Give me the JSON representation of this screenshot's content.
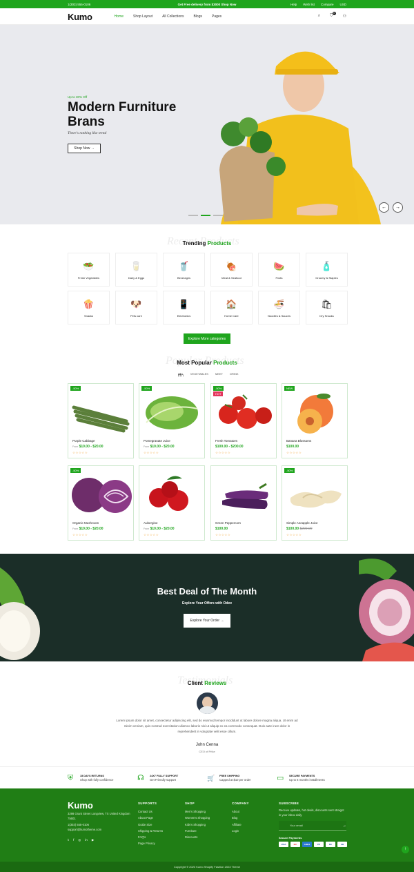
{
  "topbar": {
    "phone": "1(303) 555-0106",
    "promo": "Get Free delivery from $3000 Shop Now",
    "links": [
      "Help",
      "Wish list",
      "Compare",
      "USD"
    ]
  },
  "nav": {
    "logo": "Kumo",
    "links": [
      "Home",
      "Shop Layout",
      "All Collections",
      "Blogs",
      "Pages"
    ],
    "cart_count": "0"
  },
  "hero": {
    "discount": "Up to 30% Off",
    "title": "Modern Furniture Brans",
    "subtitle": "There's nothing like trend",
    "button": "Shop Now →",
    "prev": "←",
    "next": "→"
  },
  "trending": {
    "ghost": "Recent Products",
    "title_a": "Trending",
    "title_b": "Products",
    "categories": [
      {
        "label": "Fresh Vegetables",
        "icon": "vegetables-icon",
        "glyph": "🥗"
      },
      {
        "label": "Dairy & Eggs",
        "icon": "dairy-icon",
        "glyph": "🥛"
      },
      {
        "label": "Beverages",
        "icon": "beverages-icon",
        "glyph": "🥤"
      },
      {
        "label": "Meat & Seafood",
        "icon": "meat-icon",
        "glyph": "🍖"
      },
      {
        "label": "Fruits",
        "icon": "fruits-icon",
        "glyph": "🍉"
      },
      {
        "label": "Grocery & Staples",
        "icon": "grocery-icon",
        "glyph": "🧴"
      },
      {
        "label": "Snacks",
        "icon": "snacks-icon",
        "glyph": "🍿"
      },
      {
        "label": "Pets care",
        "icon": "pets-icon",
        "glyph": "🐶"
      },
      {
        "label": "Electronics",
        "icon": "electronics-icon",
        "glyph": "📱"
      },
      {
        "label": "Home Care",
        "icon": "home-care-icon",
        "glyph": "🏠"
      },
      {
        "label": "Noodles & Sauces",
        "icon": "noodles-icon",
        "glyph": "🍜"
      },
      {
        "label": "Dry Snacks",
        "icon": "dry-snacks-icon",
        "glyph": "🛍"
      }
    ],
    "button": "Explore More categories"
  },
  "popular": {
    "ghost": "Popular Products",
    "title_a": "Most Popular",
    "title_b": "Products",
    "tabs": [
      "ALL",
      "VEGETABLES",
      "MEET",
      "DRINK"
    ],
    "products": [
      {
        "name": "Purple Cabbage",
        "from": "From",
        "price": "$10.00 - $20.00",
        "old": "",
        "badge": "-50%",
        "badge2": "",
        "art": "asparagus"
      },
      {
        "name": "Pomegranate Juice",
        "from": "From",
        "price": "$10.00 - $20.00",
        "old": "",
        "badge": "-50%",
        "badge2": "",
        "art": "lettuce"
      },
      {
        "name": "Fresh Tomatoes",
        "from": "",
        "price": "$100.00 - $200.00",
        "old": "",
        "badge": "-50%",
        "badge2": "HOT",
        "art": "tomatoes"
      },
      {
        "name": "Banana Blossoms",
        "from": "",
        "price": "$100.00",
        "old": "",
        "badge": "NEW",
        "badge2": "",
        "art": "peach"
      },
      {
        "name": "Organic Mushroom",
        "from": "From",
        "price": "$10.00 - $20.00",
        "old": "",
        "badge": "-50%",
        "badge2": "",
        "art": "cabbage"
      },
      {
        "name": "Aubergine",
        "from": "From",
        "price": "$10.00 - $20.00",
        "old": "",
        "badge": "",
        "badge2": "",
        "art": "cherries"
      },
      {
        "name": "Green Peppercorn",
        "from": "",
        "price": "$100.00",
        "old": "",
        "badge": "",
        "badge2": "",
        "art": "eggplant"
      },
      {
        "name": "Simple Aneapple Juice",
        "from": "",
        "price": "$100.00",
        "old": "$200.00",
        "badge": "-50%",
        "badge2": "",
        "art": "ginger"
      }
    ],
    "stars": "☆☆☆☆☆"
  },
  "deal": {
    "title": "Best Deal of The Month",
    "subtitle": "Explore Your Offers with Odex",
    "button": "Explore Your Order →"
  },
  "reviews": {
    "ghost": "Testimonials",
    "title_a": "Client",
    "title_b": "Reviews",
    "text": "Lorem ipsum dolor sit amet, consectetur adipiscing elit, sed do eiusmod tempor incididunt ut labore dolore magna aliqua. Ut enim ad minim veniam, quis nostrud exercitation ullamco laboris nisi ut aliquip ex ea commodo consequat. Duis aute irure dolor in reprehenderit in voluptate velit esse cillum.",
    "name": "John Cenna",
    "role": "CEO of Prike"
  },
  "features": [
    {
      "icon": "shield-icon",
      "glyph": "⛨",
      "title": "15 DAYS RETURNS",
      "sub": "Shop with fully confidence"
    },
    {
      "icon": "headset-icon",
      "glyph": "☊",
      "title": "24X7 FULLY SUPPORT",
      "sub": "Get Friendly support"
    },
    {
      "icon": "cart-icon",
      "glyph": "🛒",
      "title": "FREE SHIPPING",
      "sub": "Capped at $10 per order"
    },
    {
      "icon": "card-icon",
      "glyph": "▭",
      "title": "SECURE PAYMENTS",
      "sub": "Up to 6 months installments"
    }
  ],
  "footer": {
    "logo": "Kumo",
    "address": "3298 Grant Street Longview, TX United Kingdom 75601",
    "phone": "1(303) 555-0106",
    "email": "support@kumotheme.com",
    "social": [
      "𝕥",
      "f",
      "◎",
      "in",
      "▶"
    ],
    "supports_title": "SUPPORTS",
    "supports": [
      "Contact Us",
      "About Page",
      "Guide Size",
      "Shipping & Returns",
      "FAQ's",
      "Page Privacy"
    ],
    "shop_title": "SHOP",
    "shop": [
      "Men's Shopping",
      "Women's Shopping",
      "Kids's Shopping",
      "Furniture",
      "Discounts"
    ],
    "company_title": "COMPANY",
    "company": [
      "About",
      "Blog",
      "Affiliate",
      "Login"
    ],
    "subscribe_title": "SUBSCRIBE",
    "subscribe_text": "Receive updates, hot deals, discounts sent straignt in your inbox daily",
    "email_placeholder": "Your email",
    "secure_title": "Secure Payments",
    "payments": [
      "VISA",
      "MC",
      "AMEX",
      "PP",
      "DC",
      "CB"
    ],
    "copyright": "Copyright © 2023 Kumo Shopify Fashion 2023 Theme",
    "colors": {
      "brand": "#1fa51d",
      "footer": "#207e15"
    }
  }
}
